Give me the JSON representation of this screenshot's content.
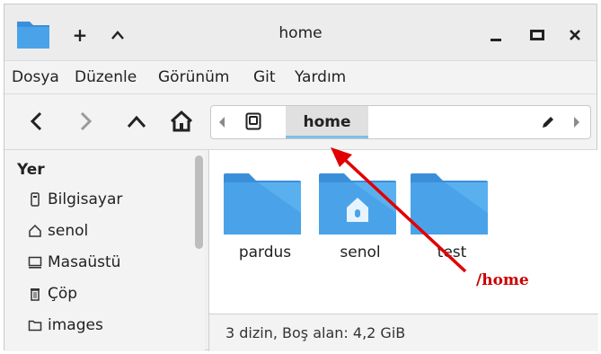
{
  "window": {
    "title": "home"
  },
  "titlebar": {
    "new_tab_label": "+",
    "up_label": "^",
    "minimize_label": "_",
    "close_label": "×"
  },
  "menu": [
    {
      "label": "Dosya"
    },
    {
      "label": "Düzenle"
    },
    {
      "label": "Görünüm"
    },
    {
      "label": "Git"
    },
    {
      "label": "Yardım"
    }
  ],
  "pathbar": {
    "current": "home"
  },
  "sidebar": {
    "heading": "Yer",
    "items": [
      {
        "label": "Bilgisayar",
        "icon": "computer-icon"
      },
      {
        "label": "senol",
        "icon": "home-icon"
      },
      {
        "label": "Masaüstü",
        "icon": "desktop-icon"
      },
      {
        "label": "Çöp",
        "icon": "trash-icon"
      },
      {
        "label": "images",
        "icon": "folder-icon"
      }
    ]
  },
  "files": [
    {
      "name": "pardus",
      "type": "folder"
    },
    {
      "name": "senol",
      "type": "home-folder"
    },
    {
      "name": "test",
      "type": "folder"
    }
  ],
  "status": {
    "text": "3 dizin, Boş alan: 4,2 GiB"
  },
  "annotation": {
    "text": "/home",
    "color": "#cc0000"
  },
  "colors": {
    "folder": "#4aa3e8",
    "accent": "#7cc0ea"
  }
}
